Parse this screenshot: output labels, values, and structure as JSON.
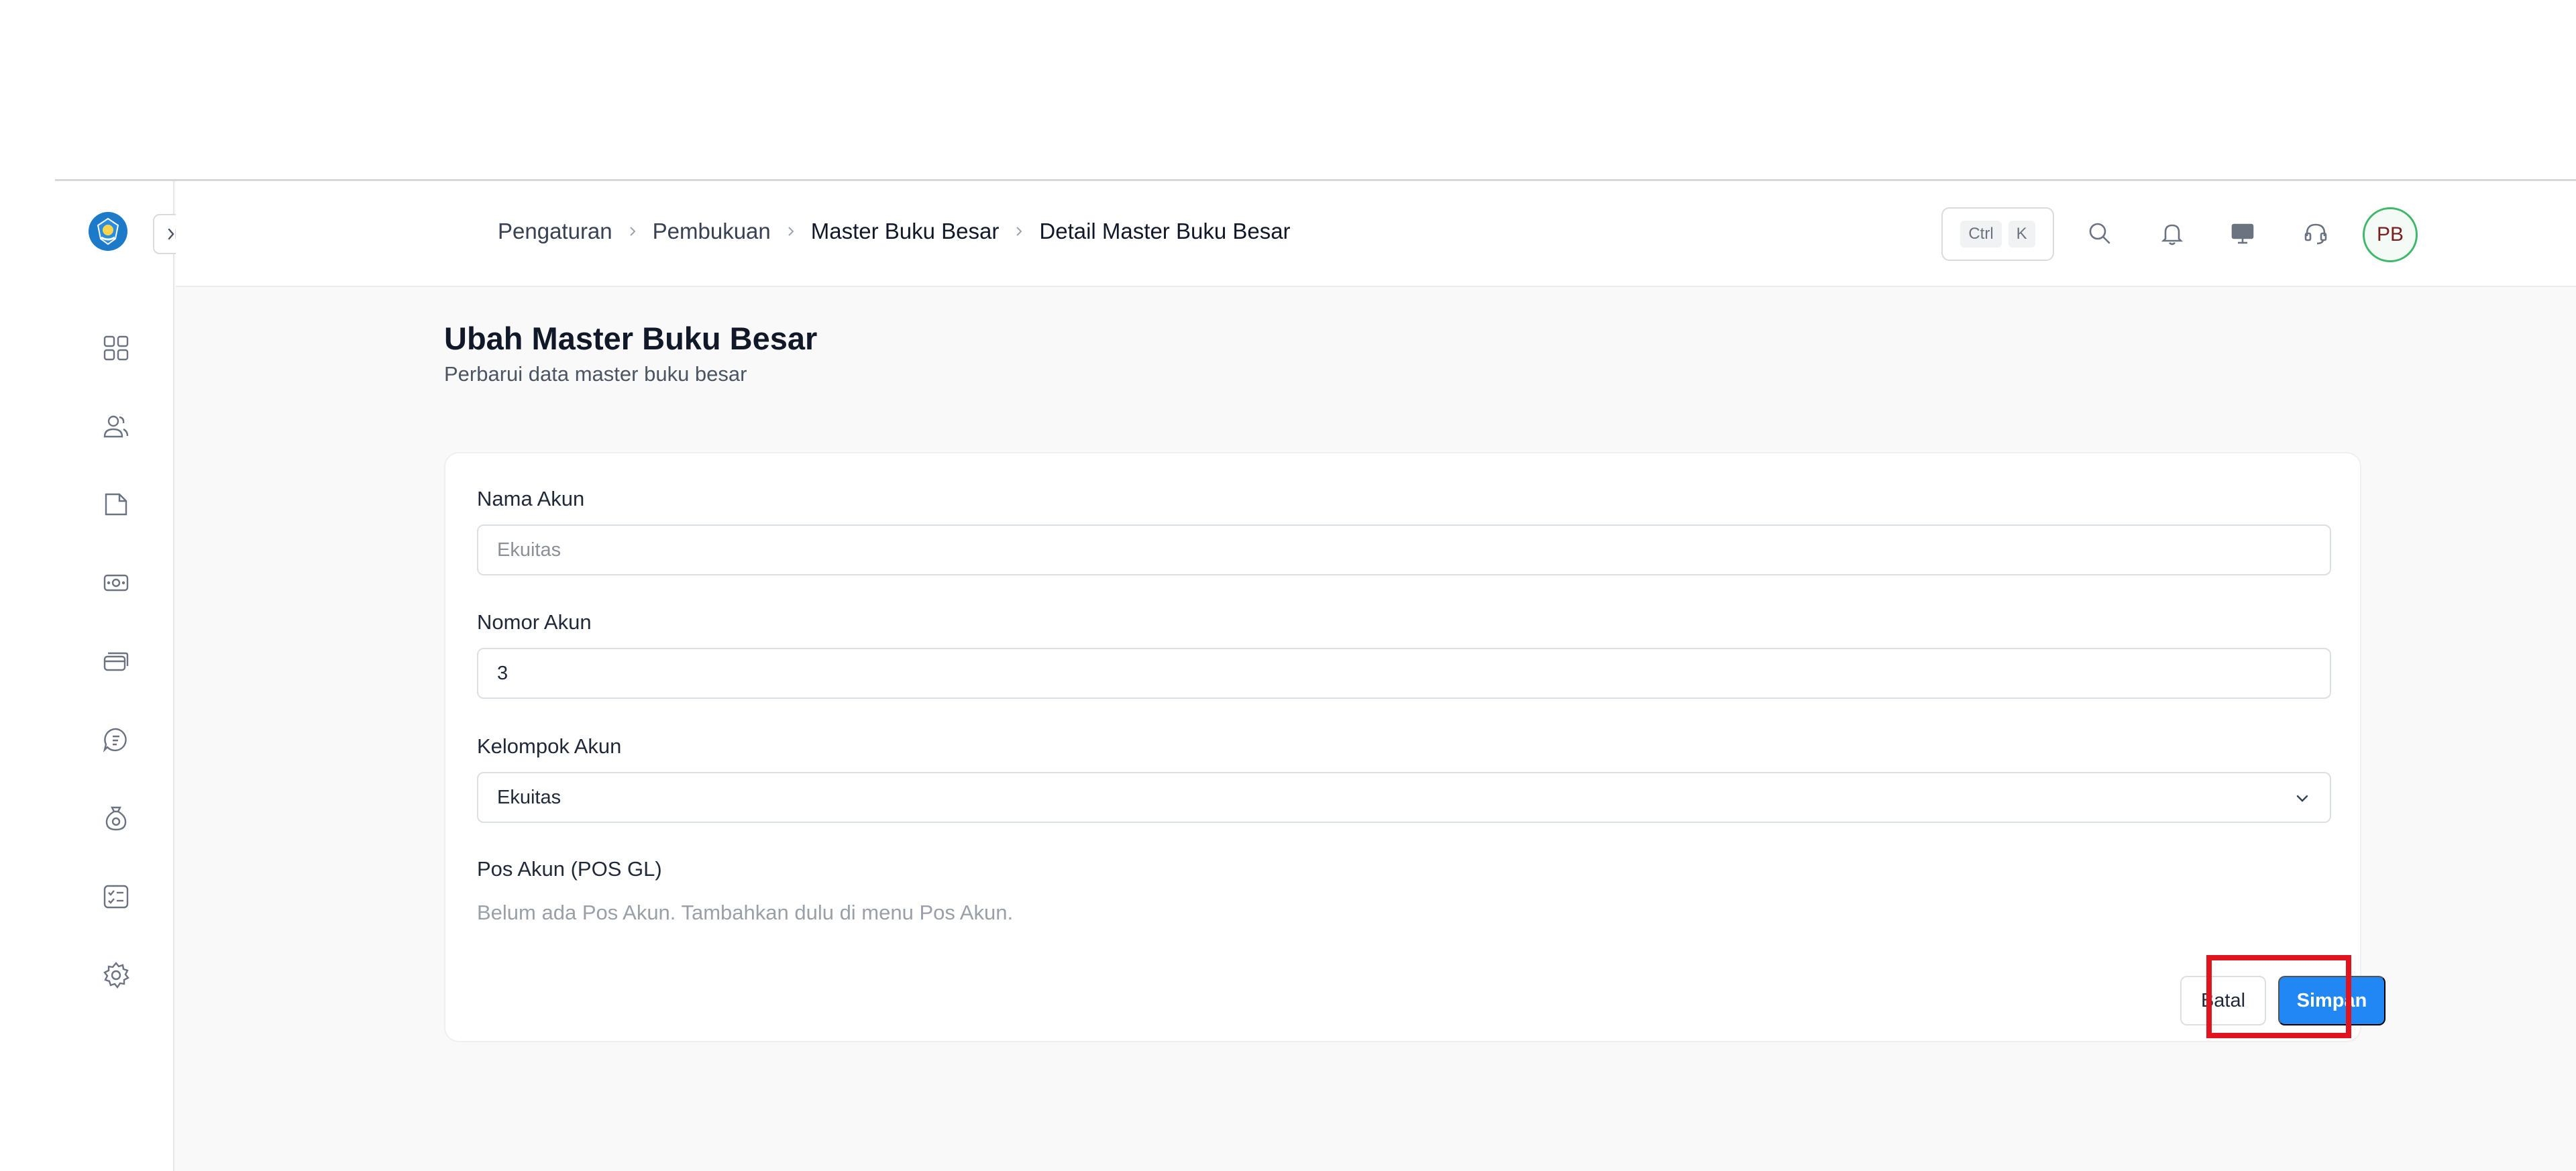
{
  "breadcrumb": {
    "items": [
      "Pengaturan",
      "Pembukuan",
      "Master Buku Besar",
      "Detail Master Buku Besar"
    ]
  },
  "shortcut": {
    "key1": "Ctrl",
    "key2": "K"
  },
  "user": {
    "initials": "PB"
  },
  "page": {
    "title": "Ubah Master Buku Besar",
    "subtitle": "Perbarui data master buku besar"
  },
  "form": {
    "account_name": {
      "label": "Nama Akun",
      "value": "",
      "placeholder": "Ekuitas"
    },
    "account_number": {
      "label": "Nomor Akun",
      "value": "3"
    },
    "account_group": {
      "label": "Kelompok Akun",
      "selected": "Ekuitas"
    },
    "gl_post": {
      "label": "Pos Akun (POS GL)",
      "empty_text": "Belum ada Pos Akun. Tambahkan dulu di menu Pos Akun."
    },
    "cancel_label": "Batal",
    "save_label": "Simpan"
  },
  "colors": {
    "primary": "#2187f5",
    "highlight": "#e0141e",
    "avatar_border": "#40b86a"
  },
  "icons": {
    "sidebar": [
      "dashboard-icon",
      "users-icon",
      "folder-icon",
      "cash-icon",
      "cards-icon",
      "chat-icon",
      "coin-bag-icon",
      "checklist-icon",
      "settings-icon"
    ],
    "topbar": [
      "search-icon",
      "bell-icon",
      "monitor-icon",
      "headset-icon"
    ]
  }
}
